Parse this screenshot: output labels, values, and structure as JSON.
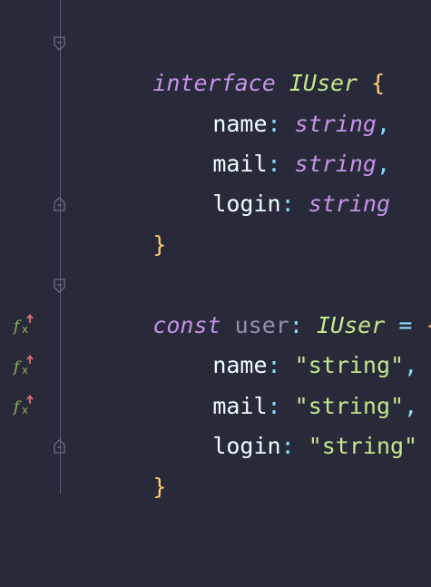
{
  "editor": {
    "interface_block": {
      "keyword": "interface",
      "name": "IUser",
      "open_brace": "{",
      "close_brace": "}",
      "fields": [
        {
          "name": "name",
          "colon": ":",
          "type": "string",
          "sep": ","
        },
        {
          "name": "mail",
          "colon": ":",
          "type": "string",
          "sep": ","
        },
        {
          "name": "login",
          "colon": ":",
          "type": "string",
          "sep": ""
        }
      ]
    },
    "const_block": {
      "keyword": "const",
      "var_name": "user",
      "colon": ":",
      "type_name": "IUser",
      "equals": "=",
      "open_brace": "{",
      "close_brace": "}",
      "fields": [
        {
          "name": "name",
          "colon": ":",
          "value": "\"string\"",
          "sep": ","
        },
        {
          "name": "mail",
          "colon": ":",
          "value": "\"string\"",
          "sep": ","
        },
        {
          "name": "login",
          "colon": ":",
          "value": "\"string\"",
          "sep": ""
        }
      ]
    },
    "gutter_icons": [
      "field-marker-icon",
      "field-marker-icon",
      "field-marker-icon"
    ],
    "colors": {
      "background": "#282a39",
      "keyword": "#c792ea",
      "type": "#c3e88d",
      "brace": "#ffcb6b",
      "string": "#c3e88d",
      "punctuation": "#89ddff",
      "variable": "#8f93a8",
      "fx_green": "#8bb55b",
      "fx_red": "#e06c75"
    }
  }
}
